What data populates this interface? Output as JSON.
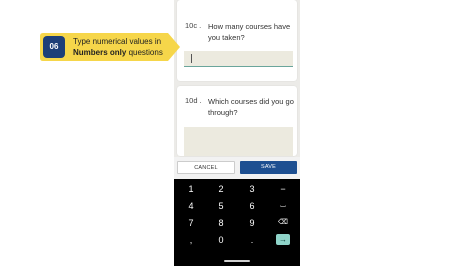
{
  "form": {
    "q1": {
      "number": "10c .",
      "text": "How many courses have you taken?",
      "value": ""
    },
    "q2": {
      "number": "10d .",
      "text": "Which courses did you go through?",
      "value": ""
    }
  },
  "actions": {
    "cancel_label": "CANCEL",
    "save_label": "SAVE"
  },
  "keyboard": {
    "rows": [
      [
        "1",
        "2",
        "3",
        "−"
      ],
      [
        "4",
        "5",
        "6",
        "⌴"
      ],
      [
        "7",
        "8",
        "9",
        "⌫"
      ],
      [
        ",",
        "0",
        ".",
        "→"
      ]
    ],
    "enter_color": "#8fd4c9"
  },
  "callout": {
    "step": "06",
    "text_before": "Type numerical values in ",
    "text_bold": "Numbers only",
    "text_after": " questions",
    "color": "#f6d64a"
  }
}
